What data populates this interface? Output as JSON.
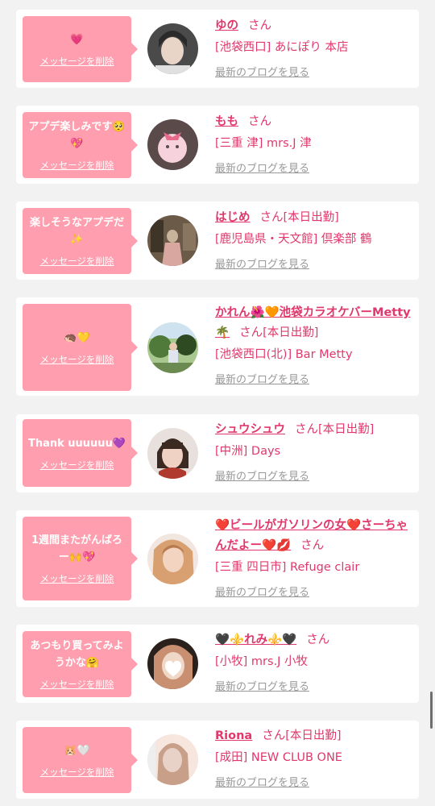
{
  "items": [
    {
      "message": "💗",
      "delete_label": "メッセージを削除",
      "name": "ゆの",
      "honorific": "さん",
      "status": "",
      "shop": "[池袋西口] あにぽり 本店",
      "blog_label": "最新のブログを見る",
      "avatar_colors": [
        "#4a4a4a",
        "#e8d5c8",
        "#2a2a2a"
      ]
    },
    {
      "message": "アプデ楽しみです🥺💖",
      "delete_label": "メッセージを削除",
      "name": "もも",
      "honorific": "さん",
      "status": "",
      "shop": "[三重 津] mrs.J 津",
      "blog_label": "最新のブログを見る",
      "avatar_colors": [
        "#5a4a4a",
        "#f6d3dc",
        "#b08080"
      ]
    },
    {
      "message": "楽しそうなアプデだ✨",
      "delete_label": "メッセージを削除",
      "name": "はじめ",
      "honorific": "さん",
      "status": "[本日出勤]",
      "shop": "[鹿児島県・天文館] 倶楽部 鶴",
      "blog_label": "最新のブログを見る",
      "avatar_colors": [
        "#6b5a48",
        "#c8b49a",
        "#3e3428"
      ]
    },
    {
      "message": "🦔💛",
      "delete_label": "メッセージを削除",
      "name": "かれん🌺🧡池袋カラオケバーMetty🌴",
      "honorific": "さん",
      "status": "[本日出勤]",
      "shop": "[池袋西口(北)] Bar Metty",
      "blog_label": "最新のブログを見る",
      "avatar_colors": [
        "#4f7a3a",
        "#a8c890",
        "#2e4a22"
      ]
    },
    {
      "message": "Thank uuuuuu💜",
      "delete_label": "メッセージを削除",
      "name": "シュウシュウ",
      "honorific": "さん",
      "status": "[本日出勤]",
      "shop": "[中洲] Days",
      "blog_label": "最新のブログを見る",
      "avatar_colors": [
        "#3a2a22",
        "#f0d2c4",
        "#b03a2e"
      ]
    },
    {
      "message": "1週間またがんばろー🙌💖",
      "delete_label": "メッセージを削除",
      "name": "❤️ビールがガソリンの女❤️さーちゃんだよー❤️💋",
      "honorific": "さん",
      "status": "",
      "shop": "[三重 四日市] Refuge clair",
      "blog_label": "最新のブログを見る",
      "avatar_colors": [
        "#d8a070",
        "#f2d4c0",
        "#b87a50"
      ]
    },
    {
      "message": "あつもり買ってみようかな🤗",
      "delete_label": "メッセージを削除",
      "name": "🖤⚜️れみ⚜️🖤",
      "honorific": "さん",
      "status": "",
      "shop": "[小牧] mrs.J 小牧",
      "blog_label": "最新のブログを見る",
      "avatar_colors": [
        "#c89070",
        "#f0d8c8",
        "#ffffff"
      ]
    },
    {
      "message": "🐹🤍",
      "delete_label": "メッセージを削除",
      "name": "Riona",
      "honorific": "さん",
      "status": "[本日出勤]",
      "shop": "[成田] NEW CLUB ONE",
      "blog_label": "最新のブログを見る",
      "avatar_colors": [
        "#e8d2c8",
        "#f6e6de",
        "#c8a08a"
      ]
    }
  ]
}
